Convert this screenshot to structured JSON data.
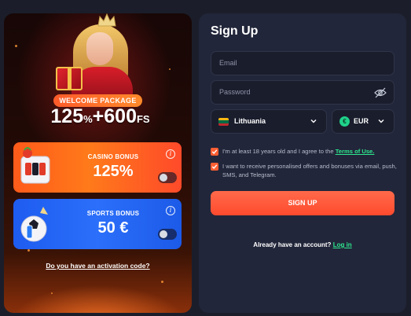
{
  "promo": {
    "welcome_label": "WELCOME PACKAGE",
    "headline_pct_value": "125",
    "headline_pct_sign": "%",
    "headline_plus": "+600",
    "headline_fs": "FS",
    "casino": {
      "title": "CASINO BONUS",
      "value": "125%",
      "info": "i",
      "enabled": false
    },
    "sports": {
      "title": "SPORTS BONUS",
      "value": "50 €",
      "info": "i",
      "enabled": false
    },
    "activation_link": "Do you have an activation code?"
  },
  "form": {
    "title": "Sign Up",
    "email_placeholder": "Email",
    "password_placeholder": "Password",
    "country": "Lithuania",
    "currency_symbol": "€",
    "currency": "EUR",
    "terms_text": "I'm at least 18 years old and I agree to the",
    "terms_link": "Terms of Use.",
    "offers_text": "I want to receive personalised offers and bonuses via email, push, SMS, and Telegram.",
    "signup_button": "SIGN UP",
    "login_prompt": "Already have an account?",
    "login_link": "Log in"
  },
  "colors": {
    "accent": "#ff5a33",
    "link": "#2ee88f",
    "casino_card": "#ff6a1a",
    "sports_card": "#2466f4",
    "panel": "#22263a"
  }
}
